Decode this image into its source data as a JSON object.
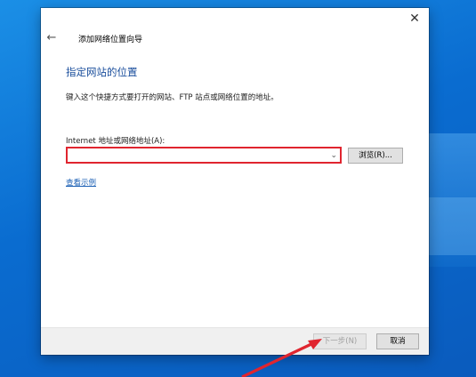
{
  "window": {
    "title": "添加网络位置向导",
    "close_icon": "✕",
    "back_icon": "←"
  },
  "main": {
    "heading": "指定网站的位置",
    "description": "键入这个快捷方式要打开的网站、FTP 站点或网络位置的地址。",
    "field_label": "Internet 地址或网络地址(A):",
    "address_value": "",
    "dropdown_icon": "chevron-down",
    "browse_label": "浏览(R)...",
    "example_link": "查看示例"
  },
  "footer": {
    "next_label": "下一步(N)",
    "cancel_label": "取消"
  },
  "colors": {
    "highlight": "#e0252f",
    "link": "#1a5fb4",
    "heading": "#1a4e9c"
  }
}
